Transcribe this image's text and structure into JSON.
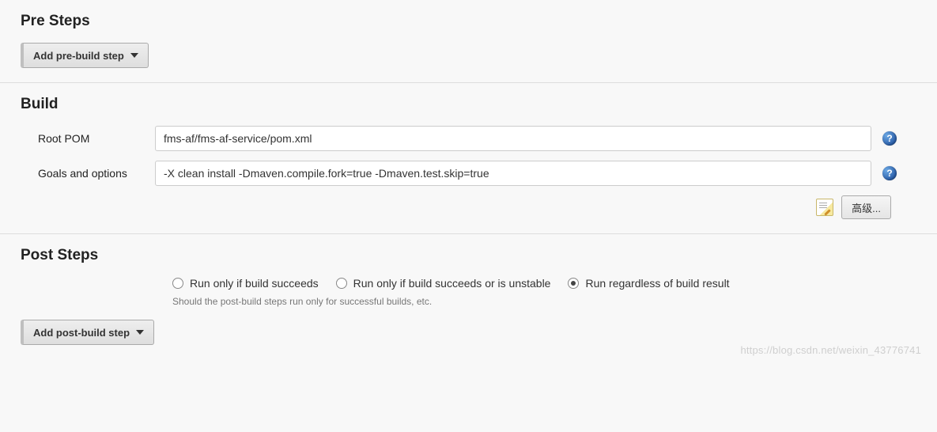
{
  "preSteps": {
    "title": "Pre Steps",
    "addButton": "Add pre-build step"
  },
  "build": {
    "title": "Build",
    "rootPom": {
      "label": "Root POM",
      "value": "fms-af/fms-af-service/pom.xml"
    },
    "goals": {
      "label": "Goals and options",
      "value": "-X clean install -Dmaven.compile.fork=true -Dmaven.test.skip=true"
    },
    "advancedButton": "高级...",
    "helpGlyph": "?"
  },
  "postSteps": {
    "title": "Post Steps",
    "options": [
      {
        "label": "Run only if build succeeds",
        "checked": false
      },
      {
        "label": "Run only if build succeeds or is unstable",
        "checked": false
      },
      {
        "label": "Run regardless of build result",
        "checked": true
      }
    ],
    "hint": "Should the post-build steps run only for successful builds, etc.",
    "addButton": "Add post-build step"
  },
  "watermark": "https://blog.csdn.net/weixin_43776741"
}
